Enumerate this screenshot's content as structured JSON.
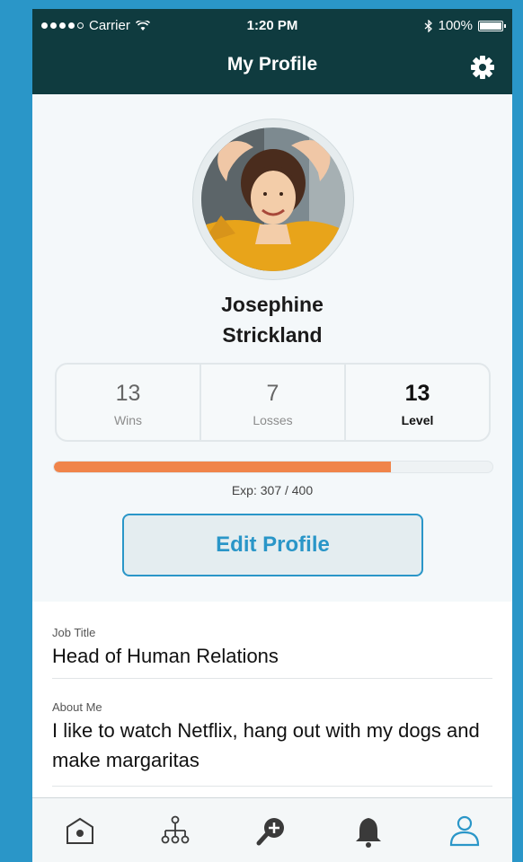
{
  "status": {
    "carrier": "Carrier",
    "time": "1:20 PM",
    "battery": "100%"
  },
  "header": {
    "title": "My Profile"
  },
  "profile": {
    "name_line1": "Josephine",
    "name_line2": "Strickland",
    "stats": [
      {
        "value": "13",
        "label": "Wins"
      },
      {
        "value": "7",
        "label": "Losses"
      },
      {
        "value": "13",
        "label": "Level"
      }
    ],
    "exp_text": "Exp: 307 / 400",
    "exp_fraction": 0.7675,
    "edit_label": "Edit Profile"
  },
  "fields": [
    {
      "label": "Job Title",
      "value": "Head of Human Relations"
    },
    {
      "label": "About Me",
      "value": "I like to watch Netflix, hang out with my dogs and make margaritas"
    }
  ],
  "tabs": [
    "home-icon",
    "org-chart-icon",
    "search-add-icon",
    "bell-icon",
    "user-icon"
  ],
  "colors": {
    "header_bg": "#0f3b3f",
    "accent": "#2a96c8",
    "progress": "#f0844a"
  }
}
